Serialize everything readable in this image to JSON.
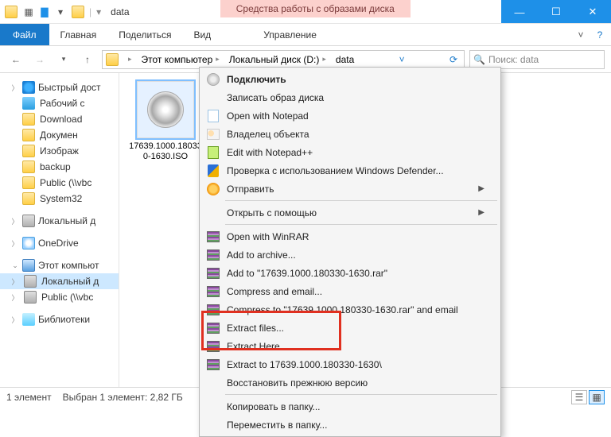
{
  "title": "data",
  "contextual_tab_title": "Средства работы с образами диска",
  "tabs": {
    "file": "Файл",
    "home": "Главная",
    "share": "Поделиться",
    "view": "Вид",
    "manage": "Управление"
  },
  "breadcrumb": {
    "seg1": "Этот компьютер",
    "seg2": "Локальный диск (D:)",
    "seg3": "data"
  },
  "search_placeholder": "Поиск: data",
  "sidebar": {
    "quick": "Быстрый дост",
    "items_quick": [
      "Рабочий с",
      "Download",
      "Докумен",
      "Изображ",
      "backup",
      "Public (\\\\vbc",
      "System32"
    ],
    "local_group": "Локальный д",
    "onedrive": "OneDrive",
    "thispc": "Этот компьют",
    "local_d": "Локальный д",
    "public_net": "Public (\\\\vbc",
    "libraries": "Библиотеки"
  },
  "file": {
    "name": "17639.1000.18033\n0-1630.ISO"
  },
  "context_menu": {
    "mount": "Подключить",
    "write": "Записать образ диска",
    "open_notepad": "Open with Notepad",
    "owner": "Владелец объекта",
    "edit_npp": "Edit with Notepad++",
    "defender": "Проверка с использованием Windows Defender...",
    "send_to": "Отправить",
    "open_with": "Открыть с помощью",
    "open_winrar": "Open with WinRAR",
    "add_archive": "Add to archive...",
    "add_to_rar": "Add to \"17639.1000.180330-1630.rar\"",
    "compress_email": "Compress and email...",
    "compress_to_email": "Compress to \"17639.1000.180330-1630.rar\" and email",
    "extract_files": "Extract files...",
    "extract_here": "Extract Here",
    "extract_to": "Extract to 17639.1000.180330-1630\\",
    "restore_prev": "Восстановить прежнюю версию",
    "copy_to": "Копировать в папку...",
    "move_to": "Переместить в папку..."
  },
  "status": {
    "count": "1 элемент",
    "selected": "Выбран 1 элемент: 2,82 ГБ"
  }
}
